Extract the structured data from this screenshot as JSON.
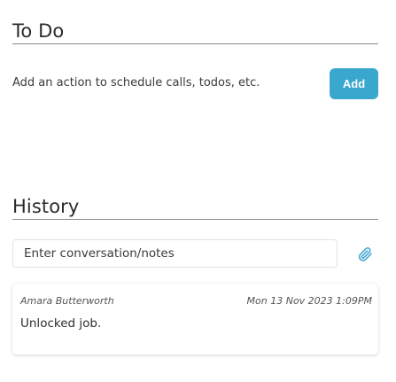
{
  "todo": {
    "title": "To Do",
    "hint": "Add an action to schedule calls, todos, etc.",
    "add_label": "Add"
  },
  "history": {
    "title": "History",
    "input_placeholder": "Enter conversation/notes",
    "attach_icon": "paperclip-icon",
    "entries": [
      {
        "author": "Amara Butterworth",
        "timestamp": "Mon 13 Nov 2023 1:09PM",
        "text": "Unlocked job."
      }
    ]
  },
  "colors": {
    "accent": "#3aa7cf",
    "rule": "#8a8a8a",
    "attach_icon": "#49a9cf"
  }
}
